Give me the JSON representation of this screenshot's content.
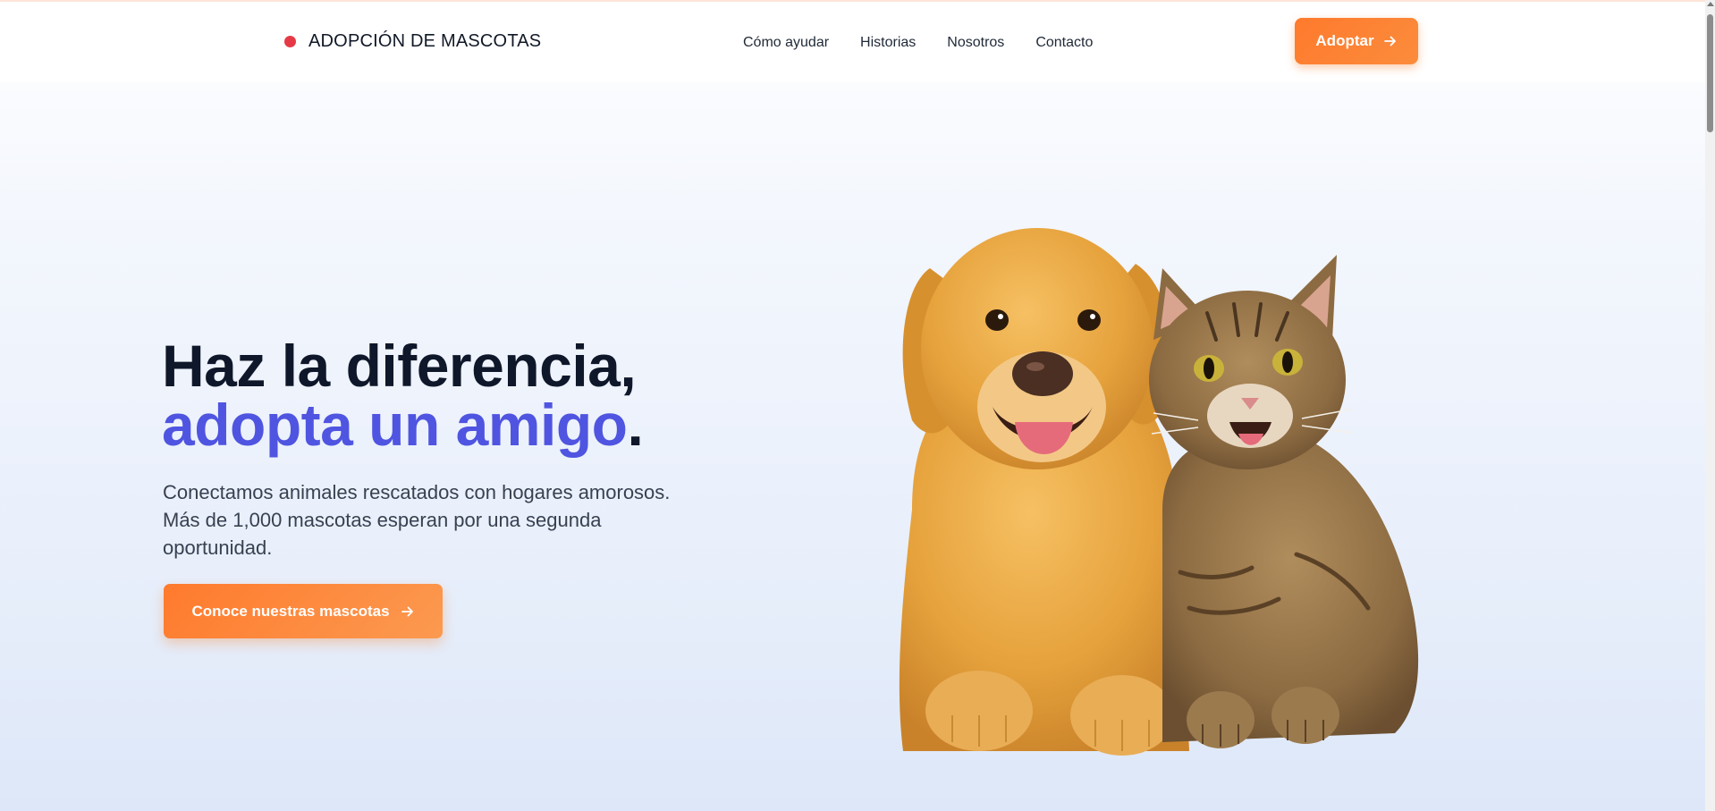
{
  "header": {
    "brand_name": "ADOPCIÓN DE MASCOTAS",
    "nav": [
      "Cómo ayudar",
      "Historias",
      "Nosotros",
      "Contacto"
    ],
    "adopt_button": "Adoptar"
  },
  "hero": {
    "title_line1": "Haz la diferencia,",
    "title_accent": "adopta un amigo",
    "title_period": ".",
    "description": "Conectamos animales rescatados con hogares amorosos. Más de 1,000 mascotas esperan por una segunda oportunidad.",
    "cta_button": "Conoce nuestras mascotas"
  },
  "colors": {
    "brand_dot": "#e63946",
    "accent": "#4f55e0",
    "button": "#ff7a2d"
  }
}
